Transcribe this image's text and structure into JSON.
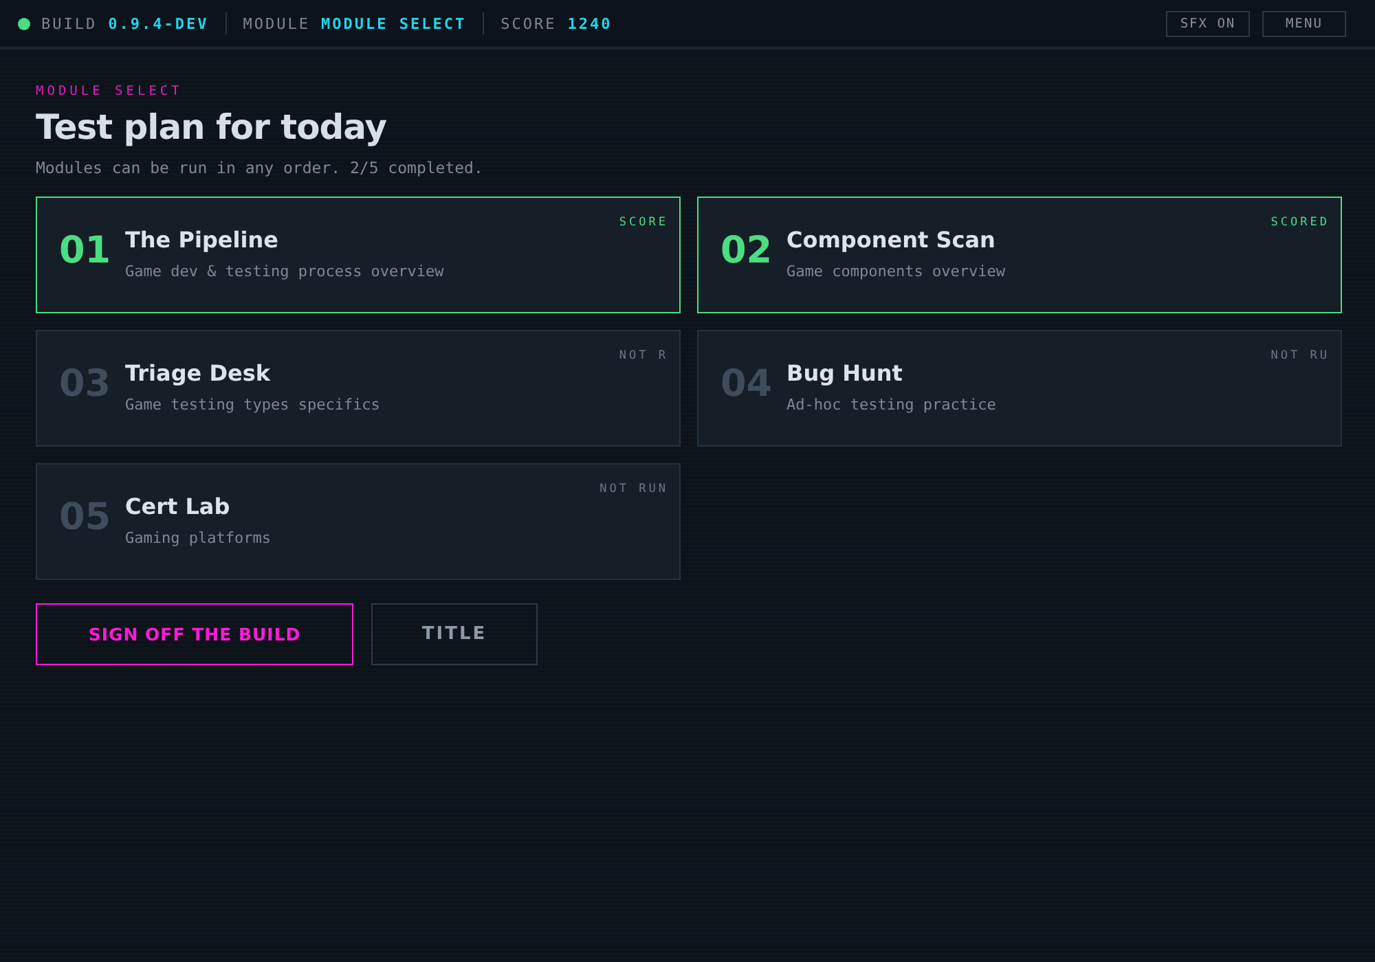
{
  "top_bar": {
    "status_on": true,
    "build_label": "BUILD",
    "build": "0.9.4-DEV",
    "module_label": "MODULE",
    "module": "MODULE SELECT",
    "score_label": "SCORE",
    "score": "1240",
    "buttons": [
      "SFX ON",
      "MENU"
    ]
  },
  "header": {
    "eyebrow": "MODULE SELECT",
    "title": "Test plan for today",
    "subtitle": "Modules can be run in any order. 2/5 completed."
  },
  "modules": [
    {
      "number": "01",
      "title": "The Pipeline",
      "description": "Game dev & testing process overview",
      "status": "SCORE",
      "completed": true
    },
    {
      "number": "02",
      "title": "Component Scan",
      "description": "Game components overview",
      "status": "SCORED",
      "completed": true
    },
    {
      "number": "03",
      "title": "Triage Desk",
      "description": "Game testing types specifics",
      "status": "NOT R",
      "completed": false
    },
    {
      "number": "04",
      "title": "Bug Hunt",
      "description": "Ad-hoc testing practice",
      "status": "NOT RU",
      "completed": false
    },
    {
      "number": "05",
      "title": "Cert Lab",
      "description": "Gaming platforms",
      "status": "NOT RUN",
      "completed": false
    }
  ],
  "actions": [
    {
      "label": "SIGN OFF THE BUILD",
      "kind": "primary"
    },
    {
      "label": "TITLE",
      "kind": "secondary"
    }
  ]
}
